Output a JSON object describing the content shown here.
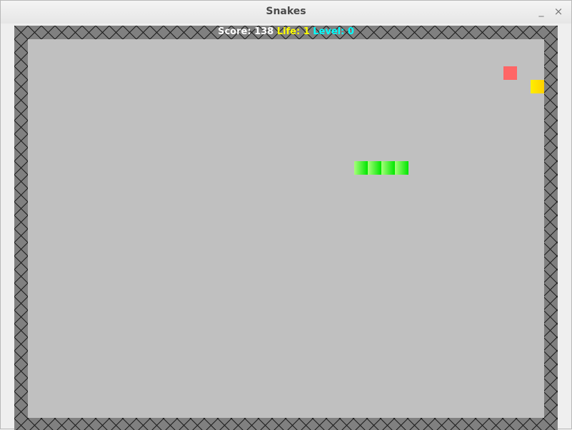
{
  "window": {
    "title": "Snakes",
    "minimize_glyph": "_",
    "close_glyph": "×"
  },
  "hud": {
    "score_label": "Score:",
    "score_value": "138",
    "life_label": "Life:",
    "life_value": "1",
    "level_label": "Level:",
    "level_value": "0"
  },
  "colors": {
    "score": "#ffffff",
    "life": "#ffff00",
    "level": "#00ffff",
    "field": "#c0c0c0",
    "wall": "#808080",
    "wall_lines": "#1a1a1a",
    "snake_light": "#a6ff7a",
    "snake_dark": "#00e600",
    "food_red": "#ff6666",
    "food_yellow": "#ffdd00"
  },
  "game": {
    "snake_segments": 4,
    "items": [
      "red-food",
      "yellow-food"
    ]
  }
}
